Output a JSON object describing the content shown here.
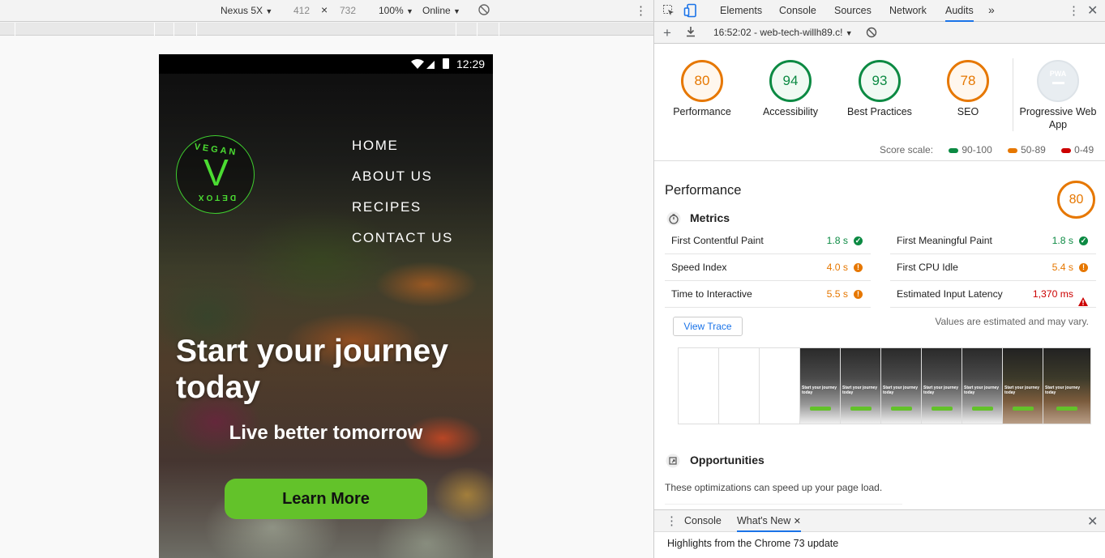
{
  "device_toolbar": {
    "device": "Nexus 5X",
    "width": "412",
    "times": "×",
    "height": "732",
    "zoom": "100%",
    "network": "Online"
  },
  "site": {
    "status_time": "12:29",
    "logo_top": "VEGAN",
    "logo_letter": "V",
    "logo_bottom": "DETOX",
    "nav": [
      "HOME",
      "ABOUT US",
      "RECIPES",
      "CONTACT US"
    ],
    "headline": "Start your journey today",
    "subheadline": "Live better tomorrow",
    "cta": "Learn More"
  },
  "devtools": {
    "tabs": [
      "Elements",
      "Console",
      "Sources",
      "Network",
      "Audits"
    ],
    "active_tab": "Audits",
    "more": "»",
    "report_selector": "16:52:02 - web-tech-willh89.c!",
    "colors": {
      "pass": "#0c8a43",
      "average": "#e67700",
      "fail": "#cc0000",
      "accent": "#1a73e8"
    },
    "categories": [
      {
        "label": "Performance",
        "score": "80",
        "score_value": 80,
        "color": "#e67700"
      },
      {
        "label": "Accessibility",
        "score": "94",
        "score_value": 94,
        "color": "#0c8a43"
      },
      {
        "label": "Best Practices",
        "score": "93",
        "score_value": 93,
        "color": "#0c8a43"
      },
      {
        "label": "SEO",
        "score": "78",
        "score_value": 78,
        "color": "#e67700"
      },
      {
        "label": "Progressive Web App",
        "score": "PWA",
        "color": "#cfd6dc"
      }
    ],
    "scale": {
      "label": "Score scale:",
      "high": "90-100",
      "mid": "50-89",
      "low": "0-49"
    },
    "performance": {
      "title": "Performance",
      "score": "80",
      "metrics_title": "Metrics",
      "metrics": [
        {
          "name": "First Contentful Paint",
          "value": "1.8 s",
          "status": "pass"
        },
        {
          "name": "First Meaningful Paint",
          "value": "1.8 s",
          "status": "pass"
        },
        {
          "name": "Speed Index",
          "value": "4.0 s",
          "status": "average"
        },
        {
          "name": "First CPU Idle",
          "value": "5.4 s",
          "status": "average"
        },
        {
          "name": "Time to Interactive",
          "value": "5.5 s",
          "status": "average"
        },
        {
          "name": "Estimated Input Latency",
          "value": "1,370 ms",
          "status": "fail"
        }
      ],
      "view_trace": "View Trace",
      "estimated_note": "Values are estimated and may vary.",
      "filmstrip_text": "Start your journey today",
      "opportunities_title": "Opportunities",
      "opportunities_desc": "These optimizations can speed up your page load."
    },
    "drawer": {
      "tabs": [
        "Console",
        "What's New"
      ],
      "active": "What's New",
      "message": "Highlights from the Chrome 73 update"
    }
  }
}
